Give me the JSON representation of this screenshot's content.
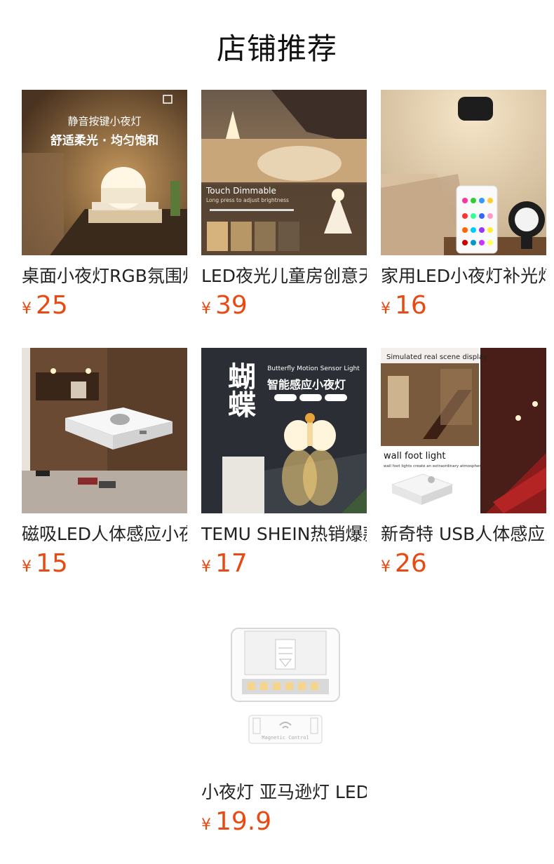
{
  "section": {
    "title": "店铺推荐"
  },
  "currency_symbol": "¥",
  "products": [
    {
      "name": "桌面小夜灯RGB氛围灯",
      "price": "25",
      "image_text": {
        "line1": "静音按键小夜灯",
        "line2": "舒适柔光 · 均匀饱和"
      }
    },
    {
      "name": "LED夜光儿童房创意天使",
      "price": "39",
      "image_text": {
        "line1": "Touch Dimmable",
        "line2": "Long press to adjust brightness"
      }
    },
    {
      "name": "家用LED小夜灯补光灯",
      "price": "16"
    },
    {
      "name": "磁吸LED人体感应小夜灯",
      "price": "15"
    },
    {
      "name": "TEMU SHEIN热销爆款",
      "price": "17",
      "image_text": {
        "line1": "Butterfly Motion Sensor Light",
        "line2": "智能感应小夜灯",
        "line3": "蝴蝶"
      }
    },
    {
      "name": "新奇特 USB人体感应灯",
      "price": "26",
      "image_text": {
        "line1": "Simulated real scene display",
        "line2": "wall  foot light",
        "line3": "wall foot lights create an extraordinary atmosphere"
      }
    },
    {
      "name": "小夜灯 亚马逊灯 LED",
      "price": "19.9",
      "image_text": {
        "line1": "Magnetic Control"
      }
    }
  ]
}
